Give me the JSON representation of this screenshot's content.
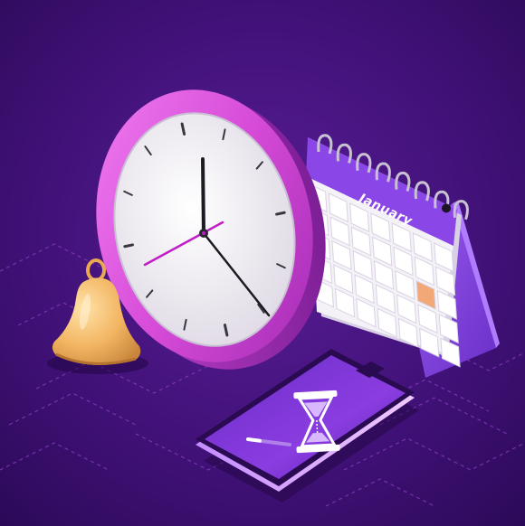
{
  "calendar": {
    "month_label": "January",
    "highlight_color": "#f3a877"
  },
  "clock": {
    "rim_color": "#d64bd8",
    "face_color": "#f1eef3",
    "second_hand_color": "#c21cc6"
  },
  "phone": {
    "icon": "hourglass-icon",
    "progress": 0.28
  },
  "bell": {
    "icon": "bell-icon",
    "color": "#f2b562"
  },
  "background": {
    "color": "#3a0f6e"
  }
}
